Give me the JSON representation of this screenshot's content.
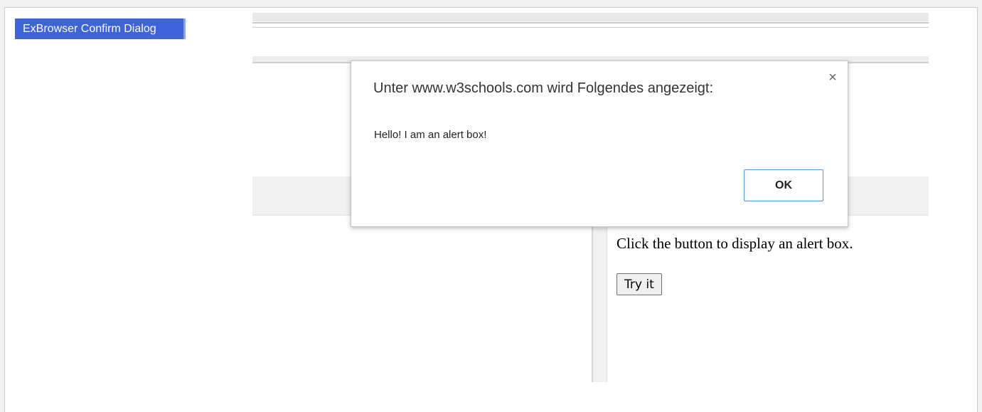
{
  "app": {
    "title": "ExBrowser Confirm Dialog"
  },
  "page": {
    "instruction": "Click the button to display an alert box.",
    "try_button_label": "Try it"
  },
  "dialog": {
    "heading": "Unter www.w3schools.com wird Folgendes angezeigt:",
    "message": "Hello! I am an alert box!",
    "ok_label": "OK",
    "close_glyph": "×"
  },
  "colors": {
    "title_bg": "#3f63d8",
    "ok_border": "#4d90fe"
  }
}
